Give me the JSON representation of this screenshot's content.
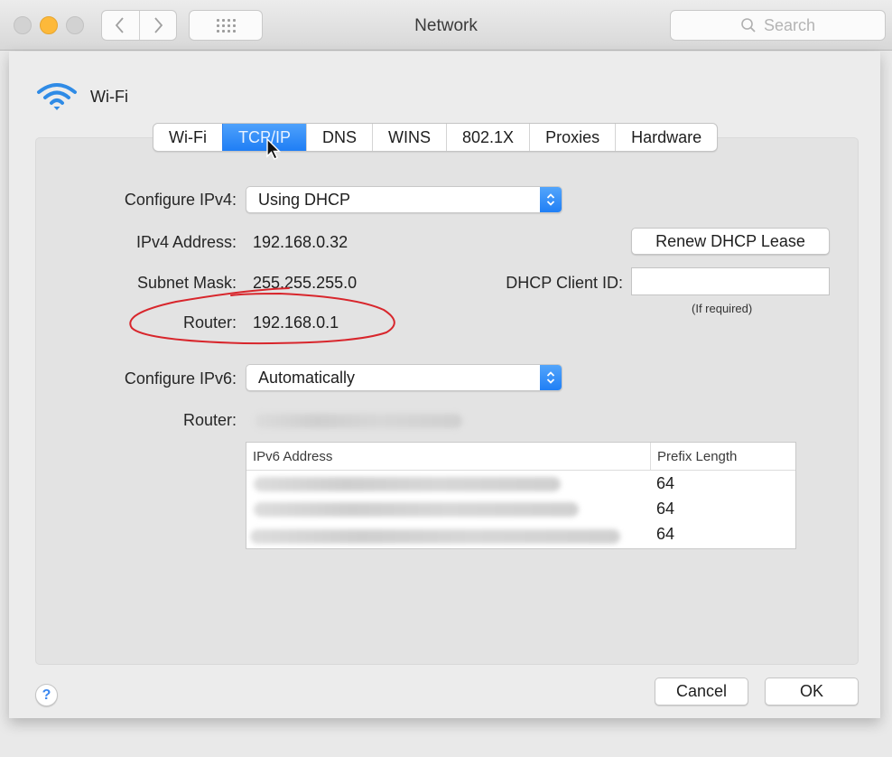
{
  "window": {
    "title": "Network",
    "search_placeholder": "Search",
    "controls": [
      "close",
      "minimize",
      "zoom"
    ],
    "nav": {
      "back": "‹",
      "forward": "›"
    }
  },
  "interface": {
    "name": "Wi-Fi",
    "icon": "wifi-icon"
  },
  "tabs": [
    {
      "label": "Wi-Fi",
      "active": false
    },
    {
      "label": "TCP/IP",
      "active": true
    },
    {
      "label": "DNS",
      "active": false
    },
    {
      "label": "WINS",
      "active": false
    },
    {
      "label": "802.1X",
      "active": false
    },
    {
      "label": "Proxies",
      "active": false
    },
    {
      "label": "Hardware",
      "active": false
    }
  ],
  "ipv4": {
    "configure_label": "Configure IPv4:",
    "configure_value": "Using DHCP",
    "address_label": "IPv4 Address:",
    "address_value": "192.168.0.32",
    "subnet_label": "Subnet Mask:",
    "subnet_value": "255.255.255.0",
    "router_label": "Router:",
    "router_value": "192.168.0.1",
    "renew_button": "Renew DHCP Lease",
    "client_id_label": "DHCP Client ID:",
    "client_id_value": "",
    "client_id_hint": "(If required)"
  },
  "ipv6": {
    "configure_label": "Configure IPv6:",
    "configure_value": "Automatically",
    "router_label": "Router:",
    "router_value": "[blurred]",
    "table": {
      "columns": [
        "IPv6 Address",
        "Prefix Length"
      ],
      "rows": [
        {
          "address": "[blurred]",
          "prefix": "64"
        },
        {
          "address": "[blurred]",
          "prefix": "64"
        },
        {
          "address": "[blurred]",
          "prefix": "64"
        }
      ]
    }
  },
  "footer": {
    "help": "?",
    "cancel": "Cancel",
    "ok": "OK"
  },
  "annotation": {
    "type": "hand-drawn-ellipse",
    "target": "router-ipv4",
    "color": "#d8262c"
  },
  "colors": {
    "accent": "#2a84f6",
    "traffic_yellow": "#fdb93a"
  }
}
